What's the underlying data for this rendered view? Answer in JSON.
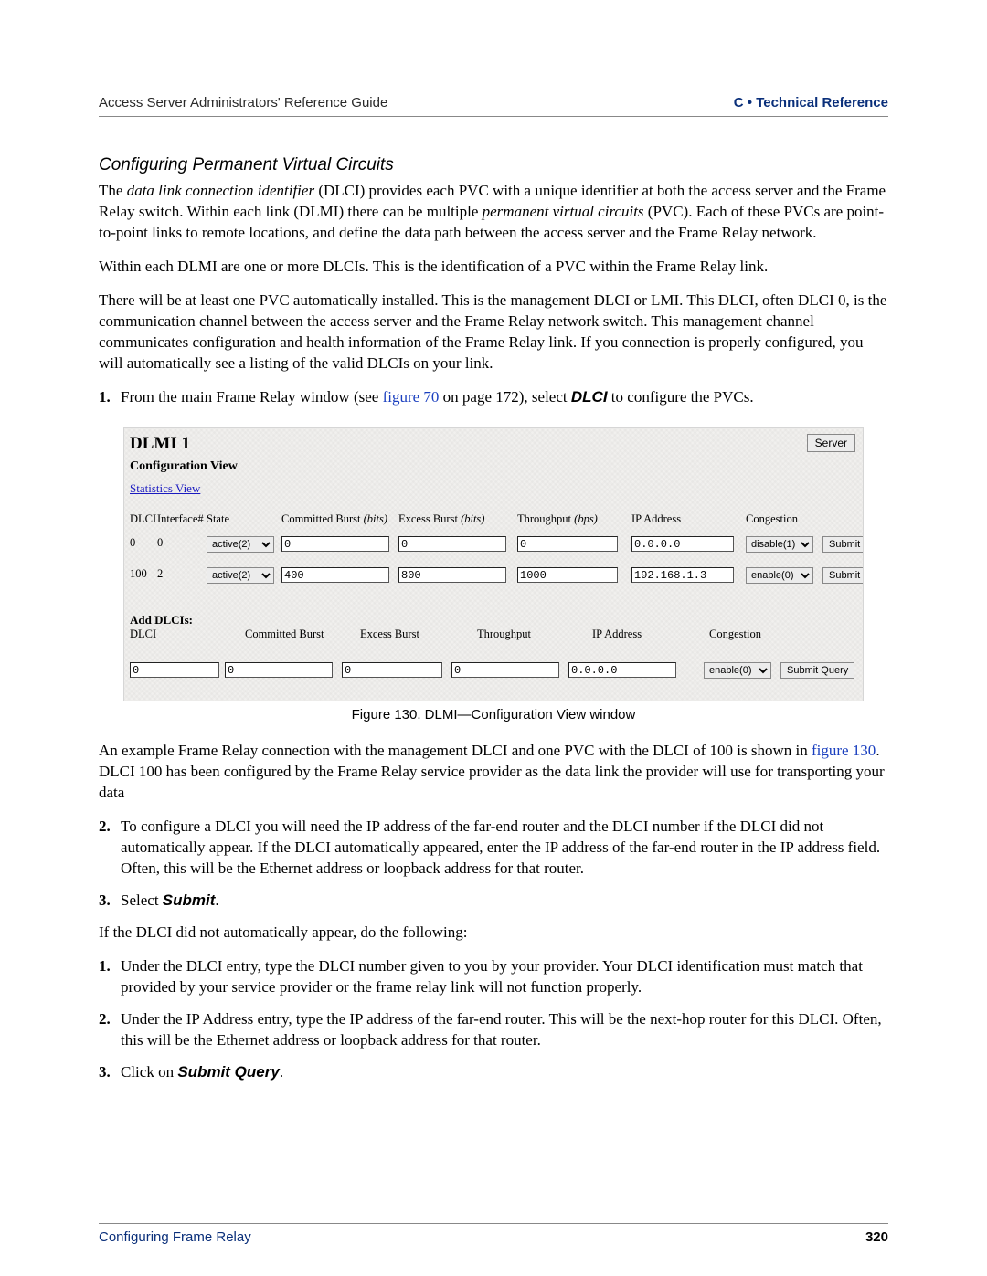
{
  "header": {
    "left": "Access Server Administrators' Reference Guide",
    "right": "C • Technical Reference"
  },
  "section_title": "Configuring Permanent Virtual Circuits",
  "para1_pre": "The ",
  "para1_ital": "data link connection identifier",
  "para1_mid": " (DLCI) provides each PVC with a unique identifier at both the access server and the Frame Relay switch. Within each link (DLMI) there can be multiple ",
  "para1_ital2": "permanent virtual circuits",
  "para1_post": " (PVC). Each of these PVCs are point-to-point links to remote locations, and define the data path between the access server and the Frame Relay network.",
  "para2": "Within each DLMI are one or more DLCIs. This is the identification of a PVC within the Frame Relay link.",
  "para3": "There will be at least one PVC automatically installed. This is the management DLCI or LMI. This DLCI, often DLCI 0, is the communication channel between the access server and the Frame Relay network switch. This management channel communicates configuration and health information of the Frame Relay link. If you connection is properly configured, you will automatically see a listing of the valid DLCIs on your link.",
  "stepA1_num": "1.",
  "stepA1_pre": "From the main Frame Relay window (see ",
  "stepA1_link": "figure 70",
  "stepA1_mid": " on page 172), select ",
  "stepA1_bold": "DLCI",
  "stepA1_post": " to configure the PVCs.",
  "fig": {
    "title": "DLMI 1",
    "server_btn": "Server",
    "subtitle": "Configuration View",
    "stats_link": "Statistics View",
    "headers": {
      "dlci": "DLCI",
      "intf": "Interface#",
      "state": "State",
      "cb": "Committed Burst",
      "cb_unit": "(bits)",
      "eb": "Excess Burst",
      "eb_unit": "(bits)",
      "tp": "Throughput",
      "tp_unit": "(bps)",
      "ip": "IP Address",
      "cong": "Congestion"
    },
    "rows": [
      {
        "dlci": "0",
        "intf": "0",
        "state": "active(2)",
        "cb": "0",
        "eb": "0",
        "tp": "0",
        "ip": "0.0.0.0",
        "cong": "disable(1)",
        "submit": "Submit"
      },
      {
        "dlci": "100",
        "intf": "2",
        "state": "active(2)",
        "cb": "400",
        "eb": "800",
        "tp": "1000",
        "ip": "192.168.1.3",
        "cong": "enable(0)",
        "submit": "Submit"
      }
    ],
    "add_title": "Add DLCIs:",
    "add_dlci_label": "DLCI",
    "add_headers": {
      "cb": "Committed Burst",
      "eb": "Excess Burst",
      "tp": "Throughput",
      "ip": "IP Address",
      "cong": "Congestion"
    },
    "add_row": {
      "dlci": "0",
      "cb": "0",
      "eb": "0",
      "tp": "0",
      "ip": "0.0.0.0",
      "cong": "enable(0)",
      "submit": "Submit Query"
    }
  },
  "figcap": "Figure 130. DLMI—Configuration View window",
  "para4_pre": "An example Frame Relay connection with the management DLCI and one PVC with the DLCI of 100 is shown in ",
  "para4_link": "figure 130",
  "para4_post": ". DLCI 100 has been configured by the Frame Relay service provider as the data link the provider will use for transporting your data",
  "stepA2_num": "2.",
  "stepA2": "To configure a DLCI you will need the IP address of the far-end router and the DLCI number if the DLCI did not automatically appear. If the DLCI automatically appeared, enter the IP address of the far-end router in the IP address field. Often, this will be the Ethernet address or loopback address for that router.",
  "stepA3_num": "3.",
  "stepA3_pre": "Select ",
  "stepA3_bold": "Submit",
  "stepA3_post": ".",
  "para5": "If the DLCI did not automatically appear, do the following:",
  "stepB1_num": "1.",
  "stepB1": "Under the DLCI entry, type the DLCI number given to you by your provider. Your DLCI identification must match that provided by your service provider or the frame relay link will not function properly.",
  "stepB2_num": "2.",
  "stepB2": "Under the IP Address entry, type the IP address of the far-end router. This will be the next-hop router for this DLCI. Often, this will be the Ethernet address or loopback address for that router.",
  "stepB3_num": "3.",
  "stepB3_pre": "Click on ",
  "stepB3_bold": "Submit Query",
  "stepB3_post": ".",
  "footer": {
    "left": "Configuring Frame Relay",
    "right": "320"
  }
}
